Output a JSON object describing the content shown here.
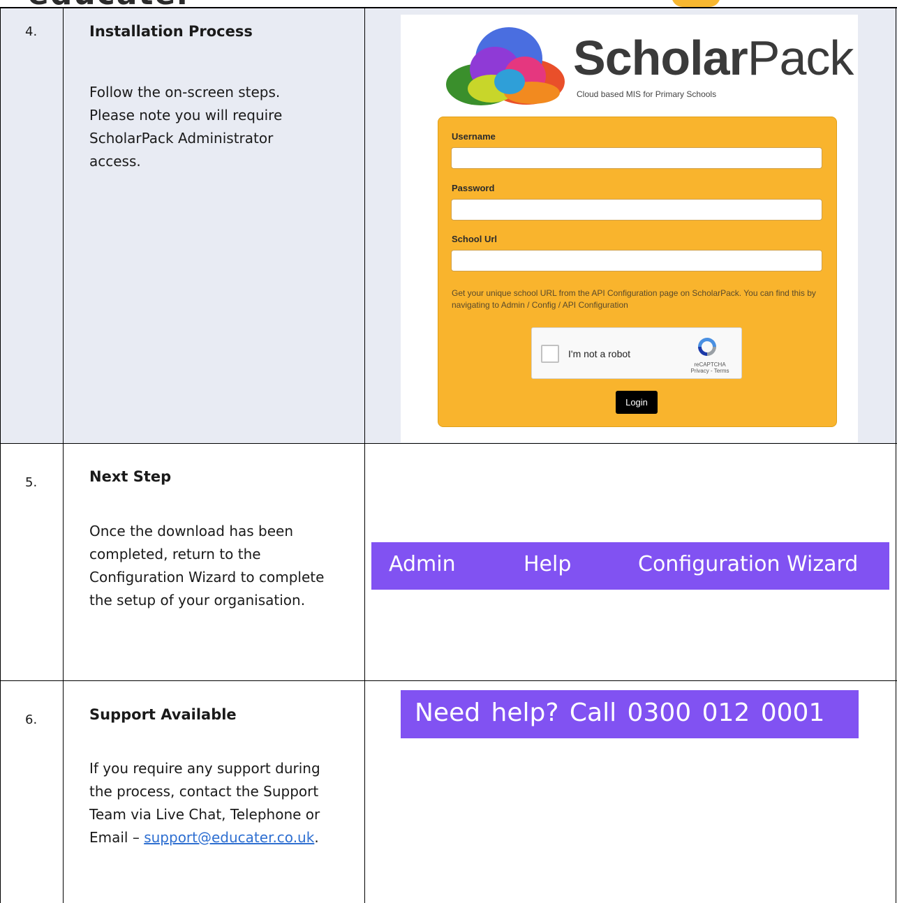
{
  "header": {
    "title_fragment": "educater"
  },
  "rows": [
    {
      "number": "4.",
      "title": "Installation Process",
      "body": "Follow the on-screen steps. Please note you will require ScholarPack Administrator access."
    },
    {
      "number": "5.",
      "title": "Next Step",
      "body": "Once the download has been completed, return to the Configuration Wizard to complete the setup of your organisation."
    },
    {
      "number": "6.",
      "title": "Support Available",
      "body_prefix": "If you require any support during the process, contact the Support Team via Live Chat, Telephone or Email – ",
      "email": "support@educater.co.uk",
      "body_suffix": "."
    }
  ],
  "login": {
    "brand_bold": "Scholar",
    "brand_light": "Pack",
    "tagline": "Cloud based MIS for Primary Schools",
    "username_label": "Username",
    "username_value": "",
    "password_label": "Password",
    "password_value": "",
    "school_url_label": "School Url",
    "school_url_value": "",
    "hint": "Get your unique school URL from the API Configuration page on ScholarPack. You can find this by navigating to Admin / Config / API Configuration",
    "captcha_label": "I'm not a robot",
    "captcha_brand": "reCAPTCHA",
    "captcha_links": "Privacy - Terms",
    "login_button": "Login",
    "accent_color": "#f9b42d"
  },
  "nav_banner": {
    "items": [
      "Admin",
      "Help",
      "Configuration Wizard"
    ],
    "color": "#8152f2"
  },
  "help_banner": {
    "text": "Need help?   Call 0300 012 0001",
    "color": "#8152f2"
  }
}
